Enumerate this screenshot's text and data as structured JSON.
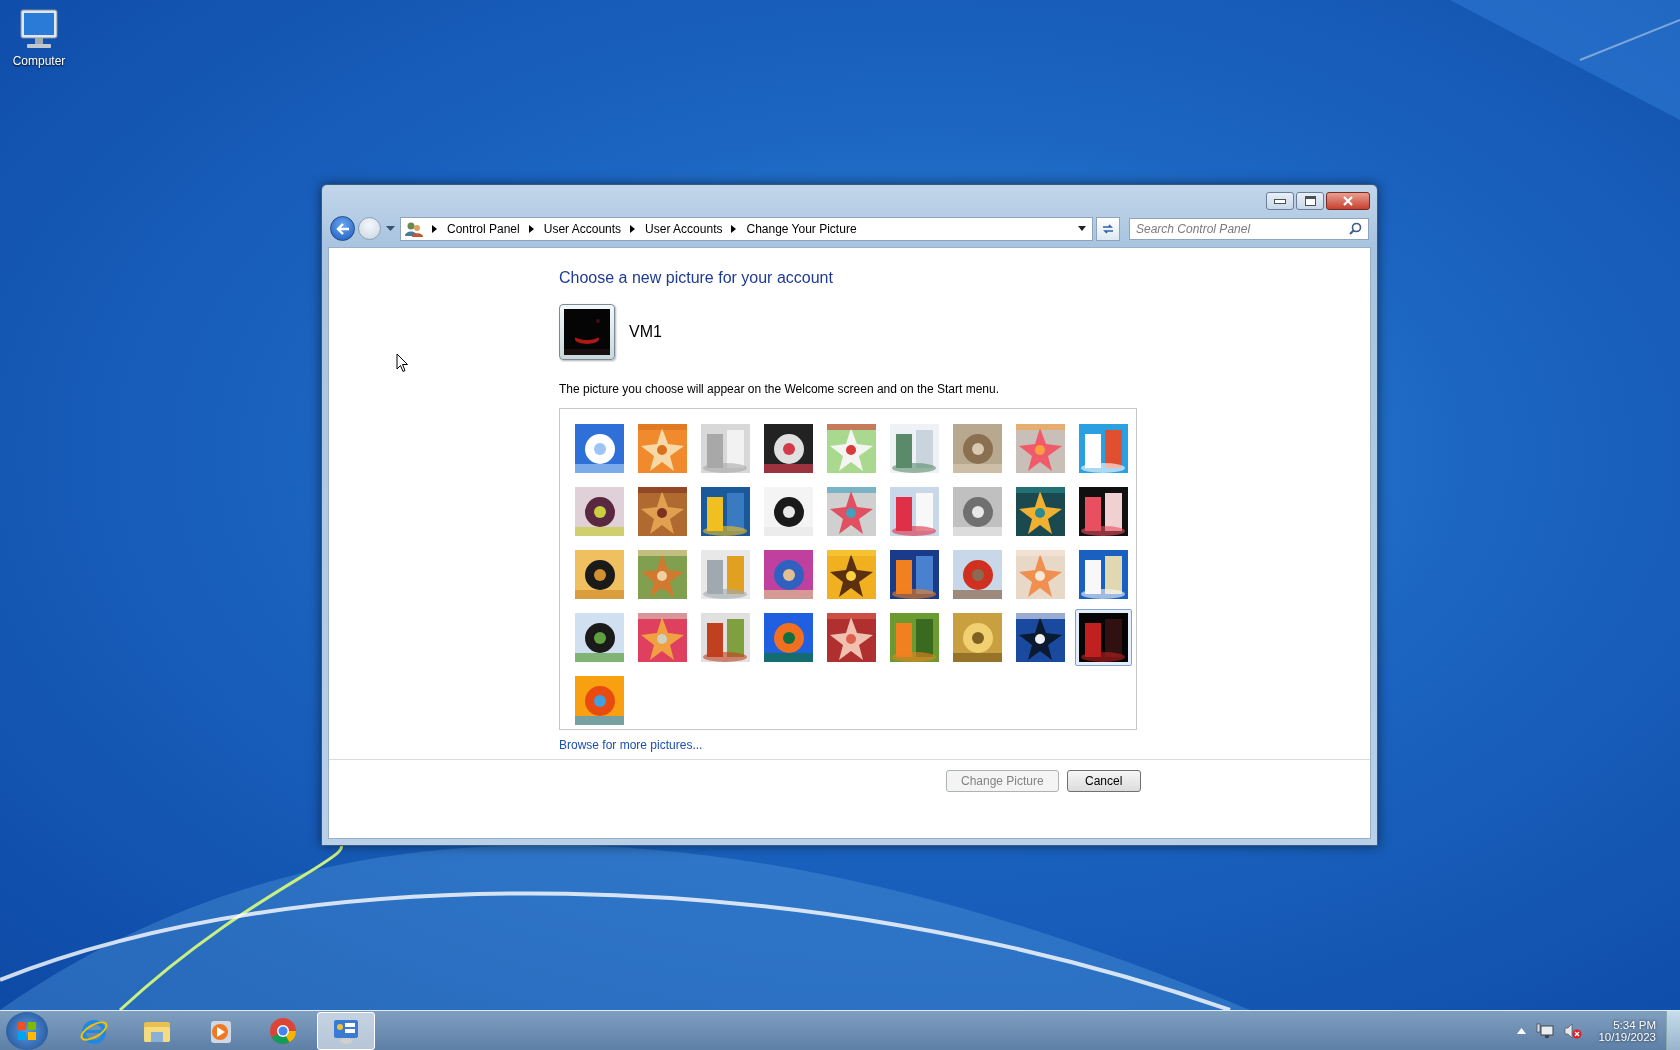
{
  "desktop": {
    "icons": [
      {
        "label": "Computer"
      }
    ]
  },
  "window": {
    "address": {
      "crumbs": [
        "Control Panel",
        "User Accounts",
        "User Accounts",
        "Change Your Picture"
      ]
    },
    "search": {
      "placeholder": "Search Control Panel"
    },
    "heading": "Choose a new picture for your account",
    "account": {
      "name": "VM1"
    },
    "description": "The picture you choose will appear on the Welcome screen and on the Start menu.",
    "pictures": [
      {
        "selected": false
      },
      {
        "selected": false
      },
      {
        "selected": false
      },
      {
        "selected": false
      },
      {
        "selected": false
      },
      {
        "selected": false
      },
      {
        "selected": false
      },
      {
        "selected": false
      },
      {
        "selected": false
      },
      {
        "selected": false
      },
      {
        "selected": false
      },
      {
        "selected": false
      },
      {
        "selected": false
      },
      {
        "selected": false
      },
      {
        "selected": false
      },
      {
        "selected": false
      },
      {
        "selected": false
      },
      {
        "selected": false
      },
      {
        "selected": false
      },
      {
        "selected": false
      },
      {
        "selected": false
      },
      {
        "selected": false
      },
      {
        "selected": false
      },
      {
        "selected": false
      },
      {
        "selected": false
      },
      {
        "selected": false
      },
      {
        "selected": false
      },
      {
        "selected": false
      },
      {
        "selected": false
      },
      {
        "selected": false
      },
      {
        "selected": false
      },
      {
        "selected": false
      },
      {
        "selected": false
      },
      {
        "selected": false
      },
      {
        "selected": false
      },
      {
        "selected": true
      },
      {
        "selected": false
      }
    ],
    "browse_link": "Browse for more pictures...",
    "buttons": [
      {
        "label": "Change Picture",
        "disabled": true
      },
      {
        "label": "Cancel",
        "disabled": false
      }
    ]
  },
  "taskbar": {
    "apps": [
      {
        "kind": "browser-e",
        "active": false
      },
      {
        "kind": "folder",
        "active": false
      },
      {
        "kind": "media",
        "active": false
      },
      {
        "kind": "chrome",
        "active": false
      },
      {
        "kind": "panel",
        "active": true
      }
    ],
    "clock": {
      "time": "5:34 PM",
      "date": "10/19/2023"
    }
  }
}
